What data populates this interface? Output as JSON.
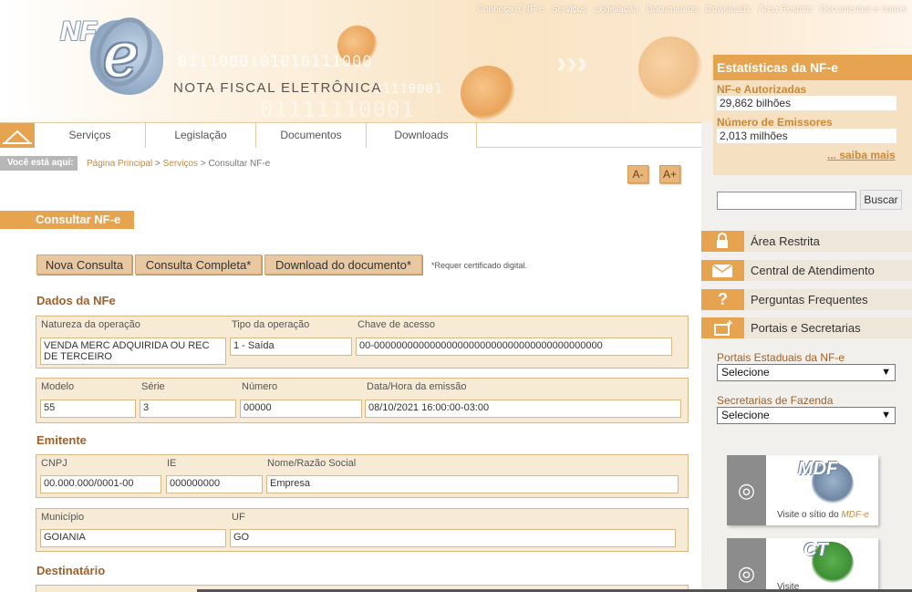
{
  "top_links": [
    "Conheça a NF-e",
    "Serviços",
    "Legislação",
    "Documentos",
    "Downloads",
    "Área Restrita",
    "Documentos e outros"
  ],
  "logo": {
    "nf": "NF",
    "e": "e",
    "title": "NOTA FISCAL ELETRÔNICA"
  },
  "header_binary": [
    "0111000101010111000",
    "01110001",
    "01111110001"
  ],
  "nav": {
    "items": [
      "Serviços",
      "Legislação",
      "Documentos",
      "Downloads"
    ]
  },
  "breadcrumb": {
    "label": "Você está aqui:",
    "items": [
      "Página Principal",
      "Serviços",
      "Consultar NF-e"
    ],
    "separator": ">"
  },
  "font_controls": {
    "decrease": "A-",
    "increase": "A+"
  },
  "page": {
    "title": "Consultar NF-e",
    "buttons": [
      "Nova Consulta",
      "Consulta Completa*",
      "Download do documento*"
    ],
    "note": "*Requer certificado digital."
  },
  "sections": {
    "dados": {
      "title": "Dados da NFe",
      "natureza_label": "Natureza da operação",
      "natureza_value": "VENDA MERC ADQUIRIDA OU REC DE TERCEIRO",
      "tipo_label": "Tipo da operação",
      "tipo_value": "1 - Saída",
      "chave_label": "Chave de acesso",
      "chave_value": "00-00000000000000000000000000000000000000000",
      "modelo_label": "Modelo",
      "modelo_value": "55",
      "serie_label": "Série",
      "serie_value": "3",
      "numero_label": "Número",
      "numero_value": "00000",
      "emissao_label": "Data/Hora da emissão",
      "emissao_value": "08/10/2021 16:00:00-03:00"
    },
    "emitente": {
      "title": "Emitente",
      "cnpj_label": "CNPJ",
      "cnpj_value": "00.000.000/0001-00",
      "ie_label": "IE",
      "ie_value": "000000000",
      "nome_label": "Nome/Razão Social",
      "nome_value": "Empresa",
      "municipio_label": "Município",
      "municipio_value": "GOIANIA",
      "uf_label": "UF",
      "uf_value": "GO"
    },
    "destinatario": {
      "title": "Destinatário"
    }
  },
  "stats": {
    "title": "Estatísticas da NF-e",
    "autorizadas_label": "NF-e Autorizadas",
    "autorizadas_value": "29,862 bilhões",
    "emissores_label": "Número de Emissores",
    "emissores_value": "2,013 milhões",
    "saiba_mais": "... saiba mais"
  },
  "search": {
    "button": "Buscar",
    "value": ""
  },
  "side_menu": [
    {
      "label": "Área Restrita",
      "icon": "lock-icon"
    },
    {
      "label": "Central de Atendimento",
      "icon": "envelope-icon"
    },
    {
      "label": "Perguntas Frequentes",
      "icon": "question-icon"
    },
    {
      "label": "Portais e Secretarias",
      "icon": "window-plus-icon"
    }
  ],
  "portais": {
    "label": "Portais Estaduais da NF-e",
    "selected": "Selecione"
  },
  "secretarias": {
    "label": "Secretarias de Fazenda",
    "selected": "Selecione"
  },
  "banners": {
    "mdfe": {
      "logo": "MDF",
      "caption_prefix": "Visite o sítio do ",
      "caption_link": "MDF-e"
    },
    "cte": {
      "logo": "CT",
      "caption_prefix": "Visite"
    }
  },
  "colors": {
    "accent": "#e6a350",
    "accent_dark": "#c88a3a",
    "panel": "#f8ebd6"
  }
}
